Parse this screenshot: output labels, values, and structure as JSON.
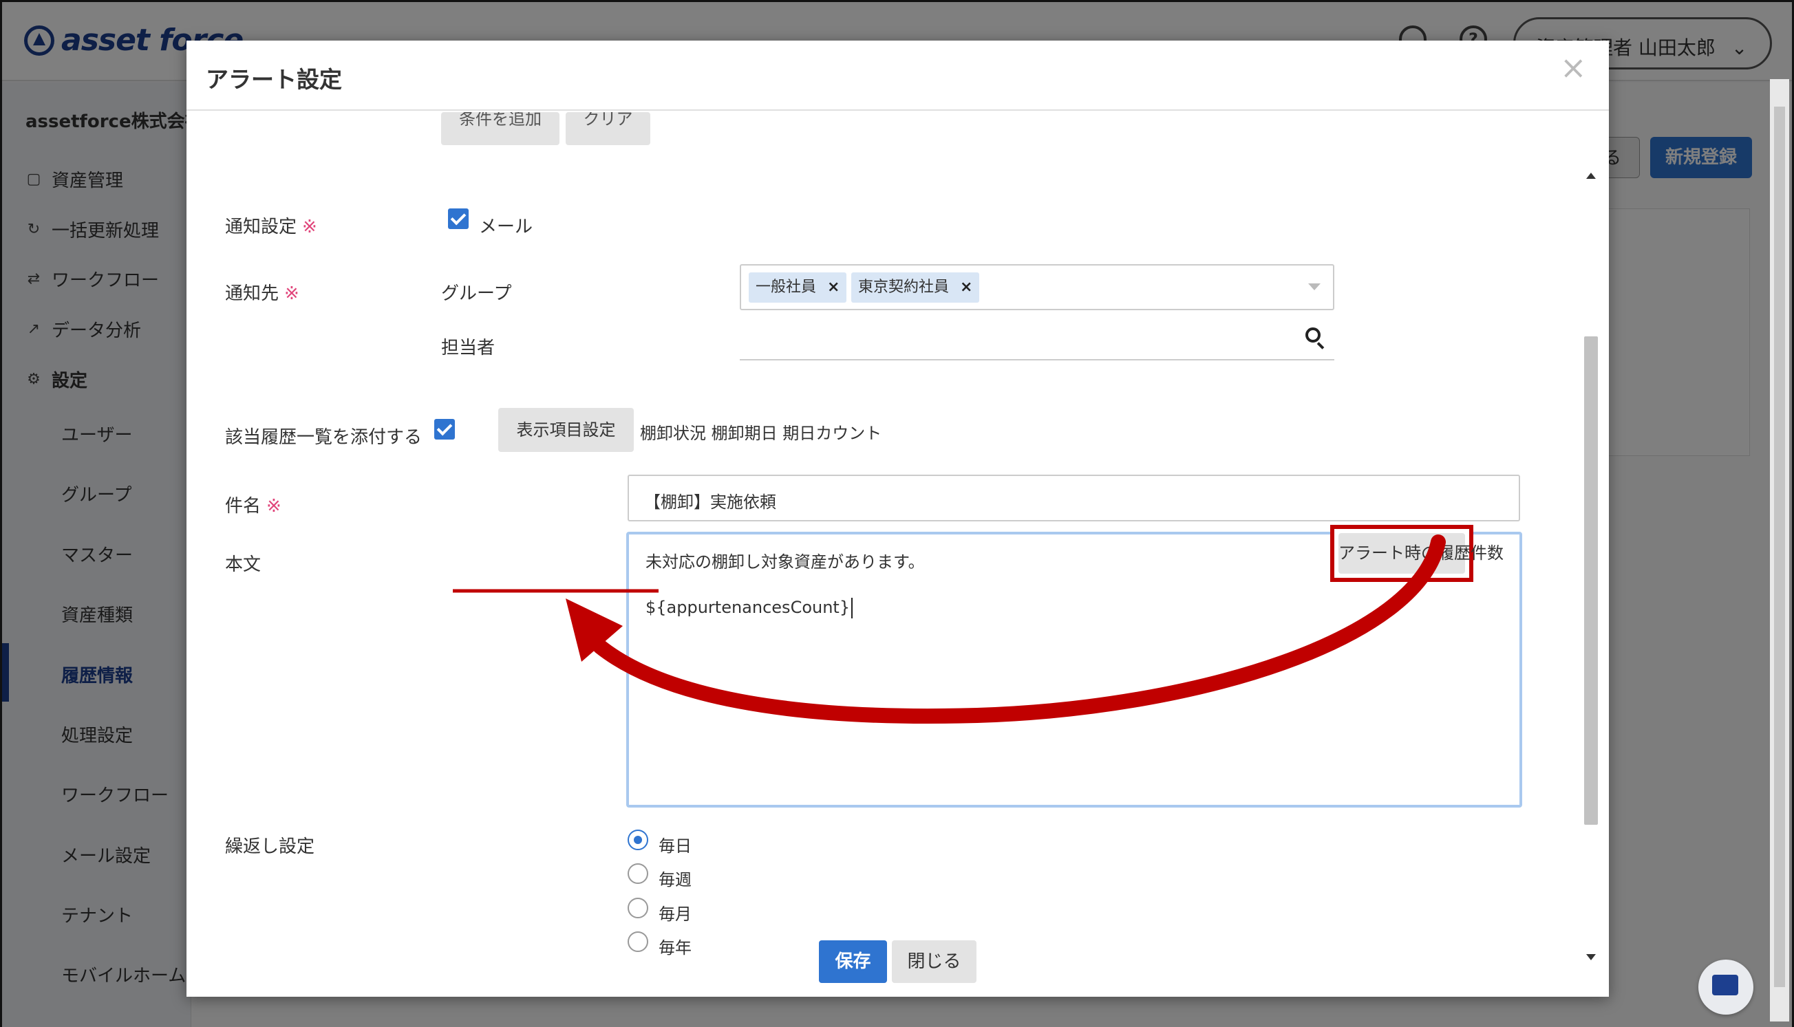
{
  "app": {
    "logo_text": "asset force",
    "user_menu_label": "資産管理者 山田太郎",
    "company": "assetforce株式会社",
    "nav": [
      {
        "label": "資産管理",
        "icon": "cube-icon"
      },
      {
        "label": "一括更新処理",
        "icon": "refresh-icon"
      },
      {
        "label": "ワークフロー",
        "icon": "workflow-icon"
      },
      {
        "label": "データ分析",
        "icon": "analytics-icon"
      },
      {
        "label": "設定",
        "icon": "gear-icon"
      }
    ],
    "settings_sub": [
      "ユーザー",
      "グループ",
      "マスター",
      "資産種類",
      "履歴情報",
      "処理設定",
      "ワークフロー",
      "メール設定",
      "テナント",
      "モバイルホーム"
    ],
    "active_sub": "履歴情報",
    "bg_button_partial": "る",
    "bg_button_new": "新規登録"
  },
  "modal": {
    "title": "アラート設定",
    "close_glyph": "×",
    "top_buttons": [
      "条件を追加",
      "クリア"
    ],
    "notify": {
      "label": "通知設定",
      "required_mark": "※",
      "mail_label": "メール",
      "mail_checked": true
    },
    "recipients": {
      "label": "通知先",
      "required_mark": "※",
      "group_label": "グループ",
      "groups": [
        "一般社員",
        "東京契約社員"
      ],
      "tag_remove": "×",
      "person_label": "担当者"
    },
    "attach": {
      "label": "該当履歴一覧を添付する",
      "checked": true,
      "button_label": "表示項目設定",
      "fields_text": "棚卸状況 棚卸期日 期日カウント"
    },
    "subject": {
      "label": "件名",
      "required_mark": "※",
      "value": "【棚卸】実施依頼"
    },
    "body": {
      "label": "本文",
      "line1": "未対応の棚卸し対象資産があります。",
      "line2": "${appurtenancesCount}",
      "insert_button": "アラート時の履歴件数"
    },
    "repeat": {
      "label": "繰返し設定",
      "options": [
        "毎日",
        "毎週",
        "毎月",
        "毎年"
      ],
      "selected": "毎日"
    },
    "footer": {
      "save": "保存",
      "close": "閉じる"
    }
  },
  "colors": {
    "primary": "#2f74d0",
    "brand": "#1d3f8f",
    "annotation": "#c00000",
    "required": "#e0447a"
  }
}
